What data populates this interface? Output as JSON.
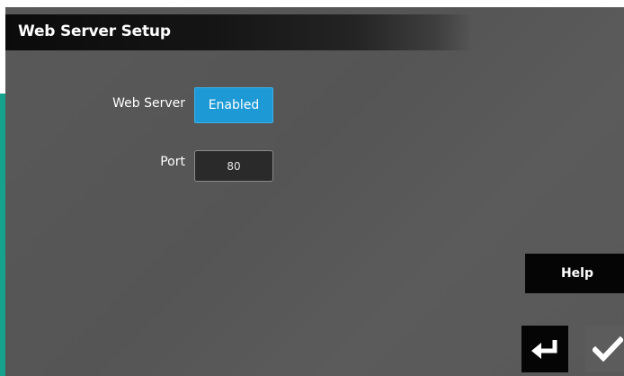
{
  "window": {
    "title": "Web Server Setup"
  },
  "form": {
    "web_server": {
      "label": "Web Server",
      "value": "Enabled"
    },
    "port": {
      "label": "Port",
      "value": "80"
    }
  },
  "actions": {
    "help_label": "Help",
    "back_icon": "return-arrow-icon",
    "confirm_icon": "checkmark-icon"
  },
  "colors": {
    "accent_blue": "#1d9ad6",
    "teal_strip": "#16a38e",
    "background": "#585858"
  }
}
